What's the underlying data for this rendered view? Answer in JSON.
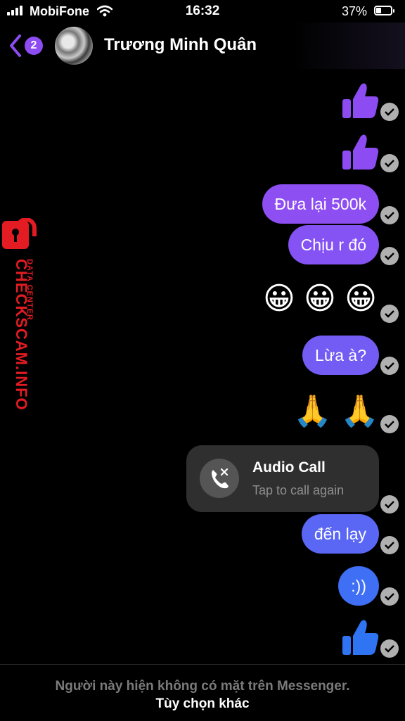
{
  "status_bar": {
    "carrier": "MobiFone",
    "time": "16:32",
    "battery_percent": "37%",
    "battery_level": 0.37,
    "signal_bars": 4
  },
  "header": {
    "back_badge": "2",
    "contact_name": "Trương Minh Quân",
    "back_icon": "chevron-left-icon",
    "avatar": "contact-avatar"
  },
  "watermark": {
    "title": "CHECKSCAM.INFO",
    "subtitle": "DATA CENTER",
    "icon": "lock-icon",
    "color": "#e31b23"
  },
  "messages": [
    {
      "type": "like",
      "color": "#8c4cf1"
    },
    {
      "type": "like",
      "color": "#8c4cf1"
    },
    {
      "type": "text",
      "text": "Đưa lại 500k",
      "color": "#8d4ef2"
    },
    {
      "type": "text",
      "text": "Chịu r đó",
      "color": "#8552f3"
    },
    {
      "type": "emoji",
      "text": "😀 😀 😀"
    },
    {
      "type": "text",
      "text": "Lừa à?",
      "color": "#735cf3"
    },
    {
      "type": "emoji",
      "text": "🙏 🙏"
    },
    {
      "type": "call",
      "title": "Audio Call",
      "subtitle": "Tap to call again",
      "icon": "missed-call-icon"
    },
    {
      "type": "text",
      "text": "đến lạy",
      "color": "#5a66f4"
    },
    {
      "type": "text",
      "text": ":))",
      "color": "#3e6ff4"
    },
    {
      "type": "like",
      "color": "#2f74f3"
    }
  ],
  "footer": {
    "note": "Người này hiện không có mặt trên Messenger.",
    "link": "Tùy chọn khác"
  },
  "colors": {
    "background": "#000000",
    "accent": "#8c4cf1",
    "check": "#b0b0b0"
  }
}
